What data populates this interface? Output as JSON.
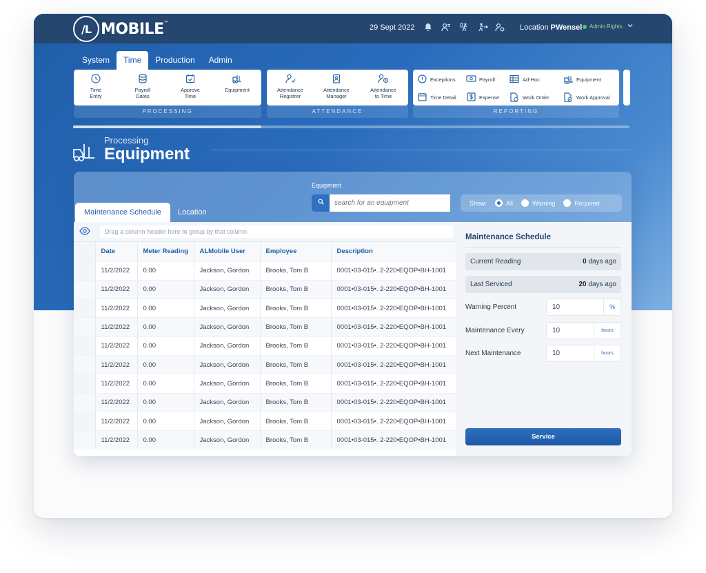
{
  "topbar": {
    "logo_mark": "/L",
    "logo_text": "MOBILE",
    "logo_tm": "™",
    "date": "29 Sept 2022",
    "location_label": "Location",
    "user": "PWensel",
    "rights": "Admin Rights",
    "icons": [
      "bell-icon",
      "team-icon",
      "clock-in-icon",
      "run-icon",
      "user-settings-icon",
      "chevron-down-icon"
    ]
  },
  "tabs": [
    {
      "label": "System"
    },
    {
      "label": "Time"
    },
    {
      "label": "Production"
    },
    {
      "label": "Admin"
    }
  ],
  "ribbon": {
    "processing": {
      "label": "PROCESSING",
      "items": [
        {
          "label1": "Time",
          "label2": "Entry",
          "icon": "clock-icon"
        },
        {
          "label1": "Payroll",
          "label2": "Dates",
          "icon": "database-icon"
        },
        {
          "label1": "Approve",
          "label2": "Time",
          "icon": "calendar-check-icon"
        },
        {
          "label1": "Equipment",
          "label2": "",
          "icon": "forklift-icon"
        }
      ]
    },
    "attendance": {
      "label": "ATTENDANCE",
      "items": [
        {
          "label1": "Attendance",
          "label2": "Registrer",
          "icon": "user-check-icon"
        },
        {
          "label1": "Attendance",
          "label2": "Manager",
          "icon": "badge-icon"
        },
        {
          "label1": "Attendance",
          "label2": "to Time",
          "icon": "user-clock-icon"
        }
      ]
    },
    "reporting": {
      "label": "REPORTING",
      "items": [
        {
          "label": "Exceptions",
          "icon": "alert-icon"
        },
        {
          "label": "Payroll",
          "icon": "money-icon"
        },
        {
          "label": "Ad-Hoc",
          "icon": "table-icon"
        },
        {
          "label": "Equipment",
          "icon": "forklift-icon"
        },
        {
          "label": "Time Detail",
          "icon": "calendar-icon"
        },
        {
          "label": "Expense",
          "icon": "dollar-icon"
        },
        {
          "label": "Work Order",
          "icon": "document-icon"
        },
        {
          "label": "Work Approval",
          "icon": "document-check-icon"
        }
      ]
    }
  },
  "page": {
    "subtitle": "Processing",
    "title": "Equipment"
  },
  "filter": {
    "equipment_label": "Equipment",
    "search_placeholder": "search for an equipment",
    "show_label": "Show:",
    "options": [
      {
        "label": "All",
        "selected": true
      },
      {
        "label": "Warning",
        "selected": false
      },
      {
        "label": "Required",
        "selected": false
      }
    ]
  },
  "panel_tabs": [
    {
      "label": "Maintenance Schedule"
    },
    {
      "label": "Location"
    }
  ],
  "grid": {
    "group_hint": "Drag a column header here to group by that column",
    "columns": [
      "Date",
      "Meter Reading",
      "ALMobile User",
      "Employee",
      "Description"
    ],
    "rows": [
      [
        "11/2/2022",
        "0.00",
        "Jackson, Gordon",
        "Brooks, Tom B",
        "0001•03-015•. 2-220•EQOP•BH-1001"
      ],
      [
        "11/2/2022",
        "0.00",
        "Jackson, Gordon",
        "Brooks, Tom B",
        "0001•03-015•. 2-220•EQOP•BH-1001"
      ],
      [
        "11/2/2022",
        "0.00",
        "Jackson, Gordon",
        "Brooks, Tom B",
        "0001•03-015•. 2-220•EQOP•BH-1001"
      ],
      [
        "11/2/2022",
        "0.00",
        "Jackson, Gordon",
        "Brooks, Tom B",
        "0001•03-015•. 2-220•EQOP•BH-1001"
      ],
      [
        "11/2/2022",
        "0.00",
        "Jackson, Gordon",
        "Brooks, Tom B",
        "0001•03-015•. 2-220•EQOP•BH-1001"
      ],
      [
        "11/2/2022",
        "0.00",
        "Jackson, Gordon",
        "Brooks, Tom B",
        "0001•03-015•. 2-220•EQOP•BH-1001"
      ],
      [
        "11/2/2022",
        "0.00",
        "Jackson, Gordon",
        "Brooks, Tom B",
        "0001•03-015•. 2-220•EQOP•BH-1001"
      ],
      [
        "11/2/2022",
        "0.00",
        "Jackson, Gordon",
        "Brooks, Tom B",
        "0001•03-015•. 2-220•EQOP•BH-1001"
      ],
      [
        "11/2/2022",
        "0.00",
        "Jackson, Gordon",
        "Brooks, Tom B",
        "0001•03-015•. 2-220•EQOP•BH-1001"
      ],
      [
        "11/2/2022",
        "0.00",
        "Jackson, Gordon",
        "Brooks, Tom B",
        "0001•03-015•. 2-220•EQOP•BH-1001"
      ]
    ]
  },
  "schedule": {
    "title": "Maintenance Schedule",
    "current_reading_label": "Current Reading",
    "current_reading_value": "0",
    "current_reading_unit": "days ago",
    "last_serviced_label": "Last Serviced",
    "last_serviced_value": "20",
    "last_serviced_unit": "days ago",
    "warning_percent_label": "Warning Percent",
    "warning_percent_value": "10",
    "warning_percent_unit": "%",
    "maintenance_every_label": "Maintenance Every",
    "maintenance_every_value": "10",
    "maintenance_every_unit": "hours",
    "next_maintenance_label": "Next Maintenance",
    "next_maintenance_value": "10",
    "next_maintenance_unit": "hours",
    "service_button": "Service"
  },
  "colors": {
    "brand_blue": "#1f5da8",
    "topbar": "#24466f",
    "admin_green": "#5fc26b"
  }
}
